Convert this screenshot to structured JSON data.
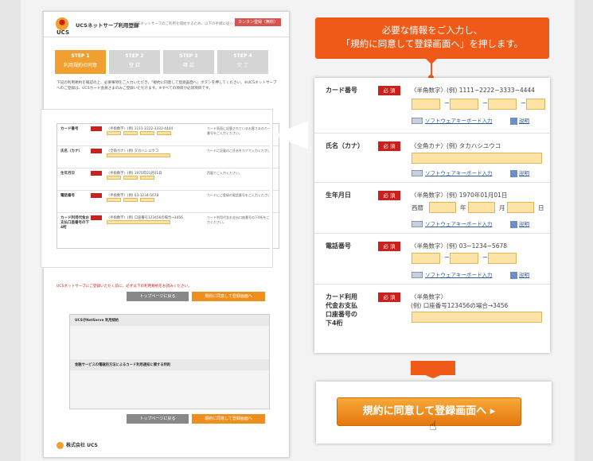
{
  "mini": {
    "title": "UCSネットサーブ利用登録",
    "subtitle": "UCSネットサーブのご利用を開始するため、以下の手順に従ってご登録ください。",
    "entry_button": "カンタン登録（無料）",
    "steps": [
      {
        "num": "STEP 1",
        "label": "利用規約の同意"
      },
      {
        "num": "STEP 2",
        "label": "登 録"
      },
      {
        "num": "STEP 3",
        "label": "確 認"
      },
      {
        "num": "STEP 4",
        "label": "完 了"
      }
    ],
    "intro": "下記の利用規約を確認の上、必要事項をご入力いただき、「規約に同意して登録画面へ」ボタンを押してください。※UCSネットサーブへのご登録は、UCSカード会員さまのみご登録いただけます。※すべての項目が必須項目です。",
    "fields": [
      {
        "label": "カード番号",
        "hint": "〈半角数字〉(例) 1111-2222-3333-4444",
        "note": "カード表面に記載されているお客さまのカード番号をご入力ください。"
      },
      {
        "label": "氏名（カナ）",
        "hint": "〈全角カナ〉(例) タカハシユウコ",
        "note": "カードに記載のご氏名をカナで入力ください。"
      },
      {
        "label": "生年月日",
        "hint": "〈半角数字〉(例) 1970年01月01日",
        "note": "西暦でご入力ください。"
      },
      {
        "label": "電話番号",
        "hint": "〈半角数字〉(例) 03-1234-5678",
        "note": "カードにご登録の電話番号をご入力ください。"
      },
      {
        "label": "カード利用代金お支払口座番号の下4桁",
        "hint": "〈半角数字〉(例) 口座番号123456の場合→3456",
        "note": "カード利用代金お支払口座番号の下4桁をご入力ください。"
      }
    ],
    "note": "UCSネットサーブにご登録いただく前に、必ず以下の利用規約をお読みください。",
    "back_button": "トップページに戻る",
    "agree_button": "規約に同意して登録画面へ",
    "terms_title": "UCS＠NetServe 利用規約",
    "terms_title2": "金融サービスの電磁的方法によるカード利用通知に関する特則",
    "footer_company": "株式会社 UCS"
  },
  "callout": {
    "line1": "必要な情報をご入力し、",
    "line2": "「規約に同意して登録画面へ」を押します。"
  },
  "zoom": {
    "required": "必 須",
    "keyboard": "ソフトウェアキーボード入力",
    "help": "説明",
    "card": {
      "label": "カード番号",
      "hint": "〈半角数字〉(例) 1111−2222−3333−4444",
      "dash": "−"
    },
    "name": {
      "label": "氏名（カナ）",
      "hint": "〈全角カナ〉(例) タカハシユウコ"
    },
    "birth": {
      "label": "生年月日",
      "hint": "〈半角数字〉(例) 1970年01月01日",
      "era": "西暦",
      "year": "年",
      "month": "月",
      "day": "日"
    },
    "phone": {
      "label": "電話番号",
      "hint": "〈半角数字〉(例) 03−1234−5678",
      "dash": "−"
    },
    "account": {
      "label1": "カード利用",
      "label2": "代金お支払",
      "label3": "口座番号の",
      "label4": "下4桁",
      "hint1": "〈半角数字〉",
      "hint2": "(例) 口座番号123456の場合→3456"
    }
  },
  "big_button": "規約に同意して登録画面へ ▸"
}
